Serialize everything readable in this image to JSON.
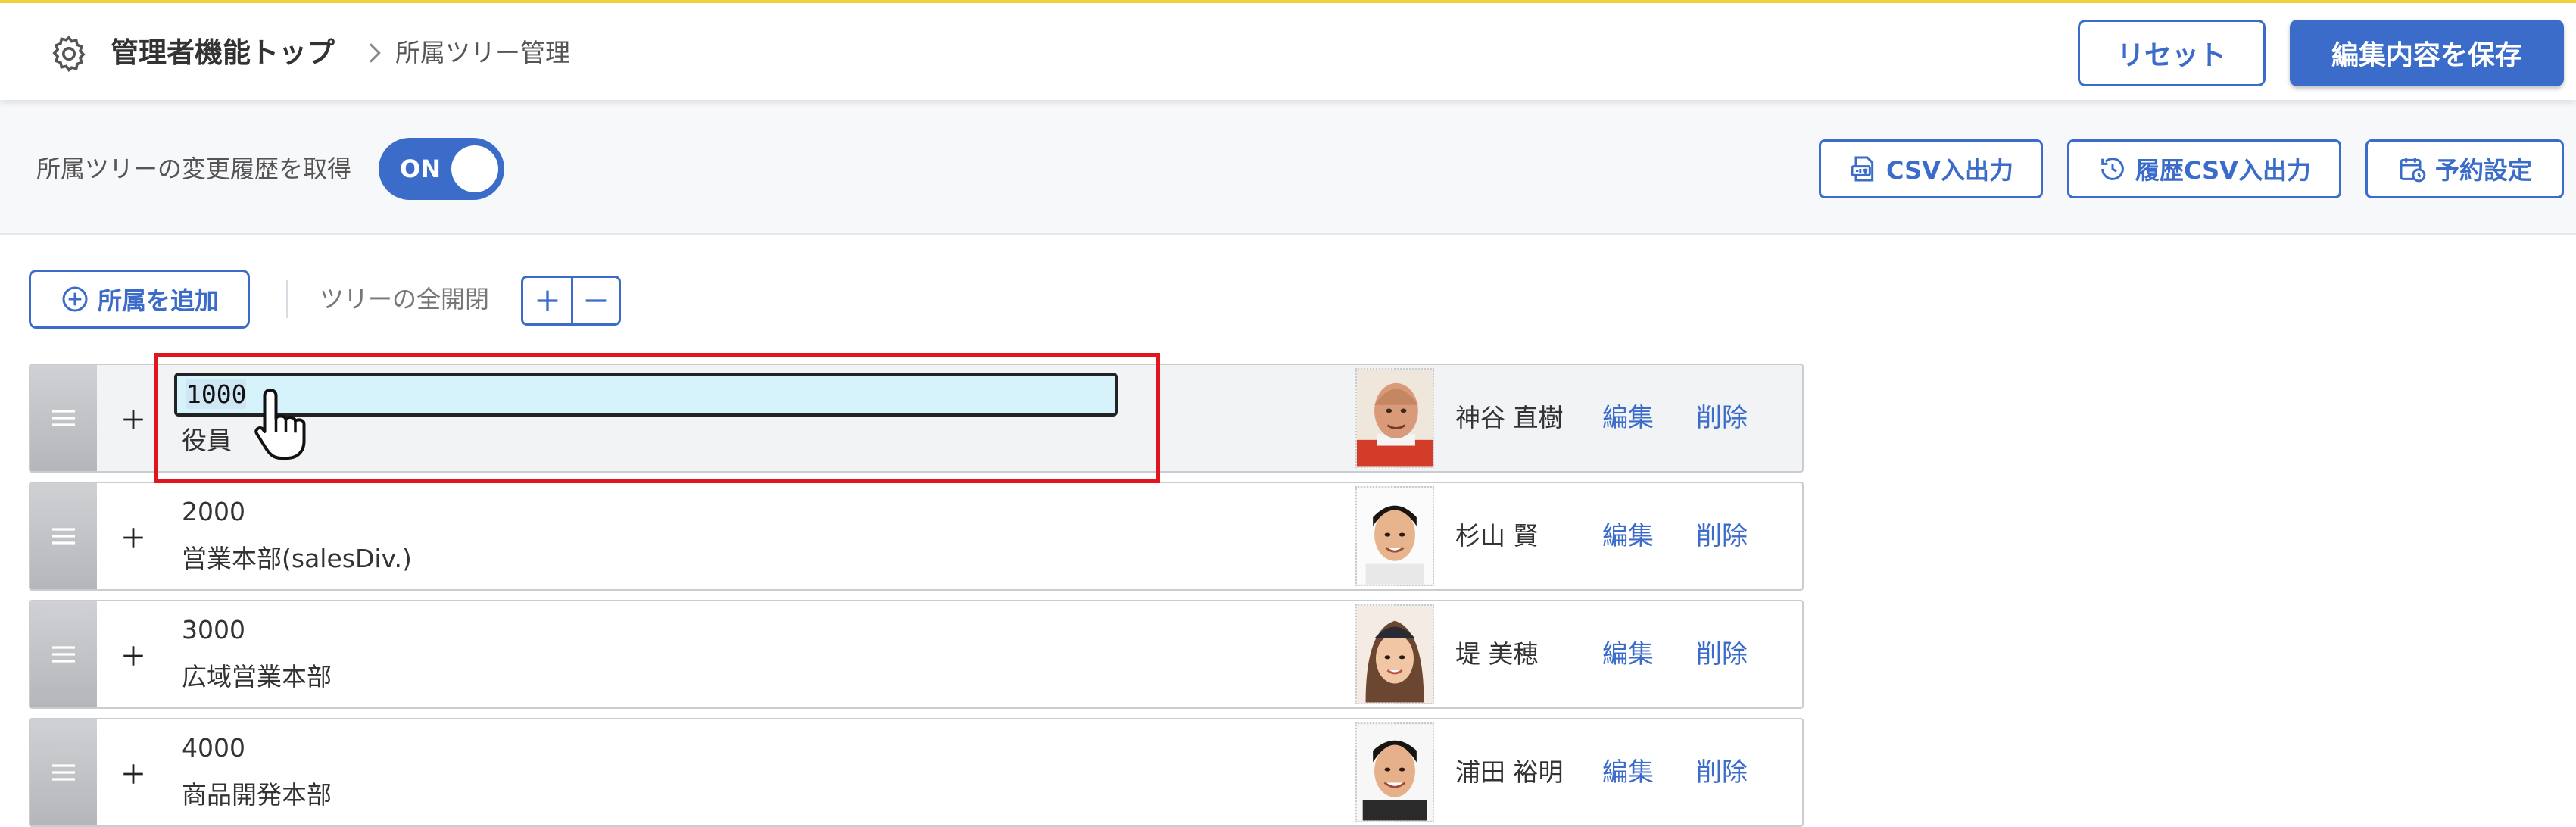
{
  "header": {
    "breadcrumb_home": "管理者機能トップ",
    "breadcrumb_current": "所属ツリー管理",
    "reset_label": "リセット",
    "save_label": "編集内容を保存"
  },
  "subbar": {
    "history_label": "所属ツリーの変更履歴を取得",
    "toggle_state": "ON",
    "csv_io_label": "CSV入出力",
    "history_csv_label": "履歴CSV入出力",
    "schedule_label": "予約設定"
  },
  "actions": {
    "add_label": "所属を追加",
    "expand_all_label": "ツリーの全開閉"
  },
  "colors": {
    "accent": "#3b6cc9",
    "highlight": "#e0151d",
    "input_bg": "#d6f2fa",
    "top_line": "#f2d23a"
  },
  "tree": {
    "nodes": [
      {
        "code": "1000",
        "name": "役員",
        "manager": "神谷 直樹",
        "edit": "編集",
        "delete": "削除"
      },
      {
        "code": "2000",
        "name": "営業本部(salesDiv.)",
        "manager": "杉山 賢",
        "edit": "編集",
        "delete": "削除"
      },
      {
        "code": "3000",
        "name": "広域営業本部",
        "manager": "堤 美穂",
        "edit": "編集",
        "delete": "削除"
      },
      {
        "code": "4000",
        "name": "商品開発本部",
        "manager": "浦田 裕明",
        "edit": "編集",
        "delete": "削除"
      }
    ]
  }
}
